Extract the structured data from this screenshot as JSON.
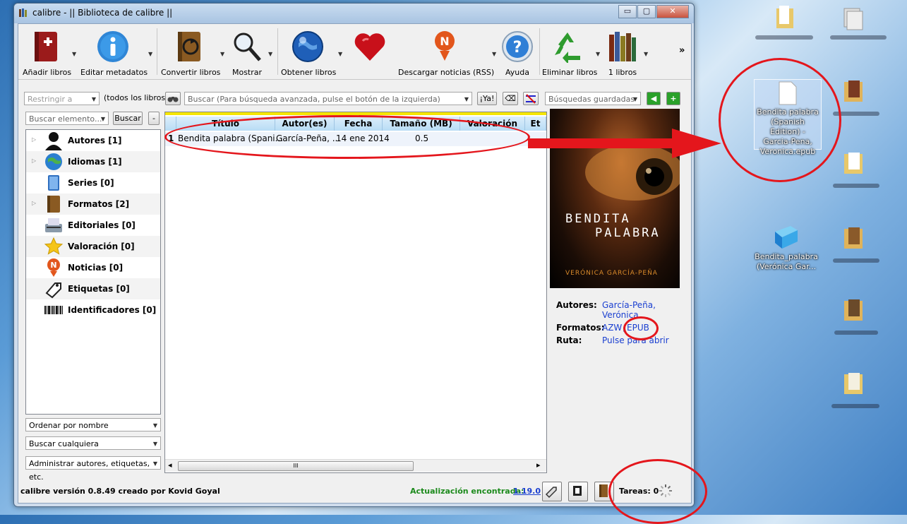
{
  "window": {
    "title": "calibre - || Biblioteca de calibre ||",
    "min": "▭",
    "max": "▢",
    "close": "✕"
  },
  "toolbar": {
    "add": "Añadir libros",
    "edit": "Editar metadatos",
    "convert": "Convertir libros",
    "view": "Mostrar",
    "get": "Obtener libros",
    "news": "Descargar noticias (RSS)",
    "help": "Ayuda",
    "remove": "Eliminar libros",
    "library": "1 libros",
    "more": "»"
  },
  "search": {
    "restrict_placeholder": "Restringir a",
    "all_books": "(todos los libros)",
    "placeholder": "Buscar (Para búsqueda avanzada, pulse el botón de la izquierda)",
    "go": "¡Ya!",
    "saved_placeholder": "Búsquedas guardadas",
    "find_item_placeholder": "Buscar elemento...",
    "find_button": "Buscar",
    "minus": "-"
  },
  "tag_browser": [
    {
      "label": "Autores [1]",
      "icon": "person-icon",
      "expandable": true
    },
    {
      "label": "Idiomas [1]",
      "icon": "globe-icon",
      "expandable": true
    },
    {
      "label": "Series [0]",
      "icon": "series-icon",
      "expandable": false
    },
    {
      "label": "Formatos [2]",
      "icon": "book-icon",
      "expandable": true
    },
    {
      "label": "Editoriales [0]",
      "icon": "typewriter-icon",
      "expandable": false
    },
    {
      "label": "Valoración [0]",
      "icon": "star-icon",
      "expandable": false
    },
    {
      "label": "Noticias [0]",
      "icon": "news-icon",
      "expandable": false
    },
    {
      "label": "Etiquetas [0]",
      "icon": "tag-icon",
      "expandable": false
    },
    {
      "label": "Identificadores [0]",
      "icon": "barcode-icon",
      "expandable": false
    }
  ],
  "sort_combo": "Ordenar por nombre",
  "match_combo": "Buscar cualquiera",
  "manage_combo": "Administrar autores, etiquetas, etc.",
  "columns": [
    "Título",
    "Autor(es)",
    "Fecha",
    "Tamaño (MB)",
    "Valoración",
    "Et"
  ],
  "books": [
    {
      "num": "1",
      "title": "Bendita palabra (Spani...",
      "author": "García-Peña, ...",
      "date": "14 ene 2014",
      "size": "0.5"
    }
  ],
  "scroll": {
    "left": "◂",
    "right": "▸",
    "grip": "III"
  },
  "cover": {
    "title_line1": "BENDITA",
    "title_line2": "PALABRA",
    "author": "VERÓNICA GARCÍA-PEÑA"
  },
  "details": {
    "authors_label": "Autores:",
    "authors_value_1": "García-Peña,",
    "authors_value_2": "Verónica",
    "formats_label": "Formatos:",
    "format_azw": "AZW",
    "format_sep": ",",
    "format_epub": "EPUB",
    "path_label": "Ruta:",
    "path_value": "Pulse para abrir"
  },
  "status": {
    "version": "calibre versión 0.8.49 creado por Kovid Goyal",
    "update_label": "Actualización encontrada:",
    "update_link": "1.19.0",
    "jobs": "Tareas: 0"
  },
  "desktop": {
    "epub_file": "Bendita palabra (Spanish Edition) - Garcia-Pena, Veronica.epub",
    "folder_name_1": "Bendita_palabra",
    "folder_name_2": "(Verónica Gar..."
  },
  "colors": {
    "annotation": "#e4161c",
    "link": "#1a3fd0",
    "update": "#1c8a1c",
    "highlight": "#f5e500"
  }
}
